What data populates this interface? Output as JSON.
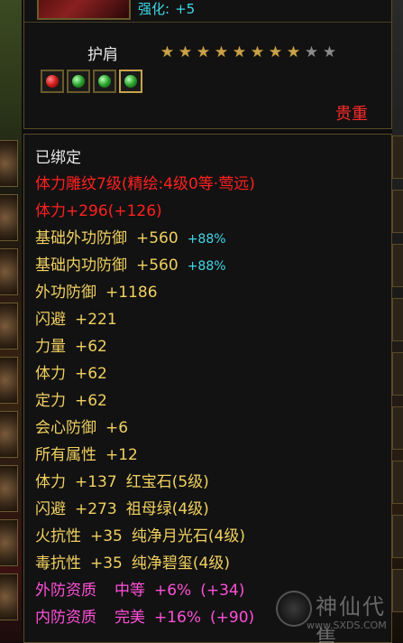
{
  "item": {
    "enhance_label": "强化:",
    "enhance_value": "+5",
    "slot_name": "护肩",
    "stars": {
      "filled": 8,
      "total": 10
    },
    "gems": [
      {
        "icon": "ruby-gem-icon",
        "color": "#d01a1a"
      },
      {
        "icon": "emerald-gem-icon",
        "color": "#2aa02a"
      },
      {
        "icon": "emerald-gem-icon",
        "color": "#2aa02a"
      },
      {
        "icon": "emerald-gem-icon",
        "color": "#2aa02a"
      }
    ],
    "rarity": "贵重"
  },
  "stats": {
    "bound": "已绑定",
    "carving": "体力雕纹7级(精绘:4级0等·莺远)",
    "stamina_main": "体力+296(+126)",
    "base_ext_def_label": "基础外功防御",
    "base_ext_def_value": "+560",
    "base_ext_def_pct": "+88%",
    "base_int_def_label": "基础内功防御",
    "base_int_def_value": "+560",
    "base_int_def_pct": "+88%",
    "lines": [
      {
        "label": "外功防御",
        "value": "+1186"
      },
      {
        "label": "闪避",
        "value": "+221"
      },
      {
        "label": "力量",
        "value": "+62"
      },
      {
        "label": "体力",
        "value": "+62"
      },
      {
        "label": "定力",
        "value": "+62"
      },
      {
        "label": "会心防御",
        "value": "+6"
      },
      {
        "label": "所有属性",
        "value": "+12"
      }
    ],
    "gem_lines": [
      {
        "label": "体力",
        "value": "+137",
        "gem": "红宝石",
        "level": "(5级)"
      },
      {
        "label": "闪避",
        "value": "+273",
        "gem": "祖母绿",
        "level": "(4级)"
      },
      {
        "label": "火抗性",
        "value": "+35",
        "gem": "纯净月光石",
        "level": "(4级)"
      },
      {
        "label": "毒抗性",
        "value": "+35",
        "gem": "纯净碧玺",
        "level": "(4级)"
      }
    ],
    "ext_quality_label": "外防资质",
    "ext_quality_grade": "中等",
    "ext_quality_pct": "+6%",
    "ext_quality_bonus": "(+34)",
    "int_quality_label": "内防资质",
    "int_quality_grade": "完美",
    "int_quality_pct": "+16%",
    "int_quality_bonus": "(+90)"
  },
  "watermark": {
    "name": "神仙代售",
    "url": "www.SXDS.COM"
  },
  "colors": {
    "cyan": "#3fd8e8",
    "red": "#ff2020",
    "gold": "#f0d060",
    "pink": "#ff50d8",
    "white": "#e8e8e8",
    "border": "#5a4a2a"
  }
}
